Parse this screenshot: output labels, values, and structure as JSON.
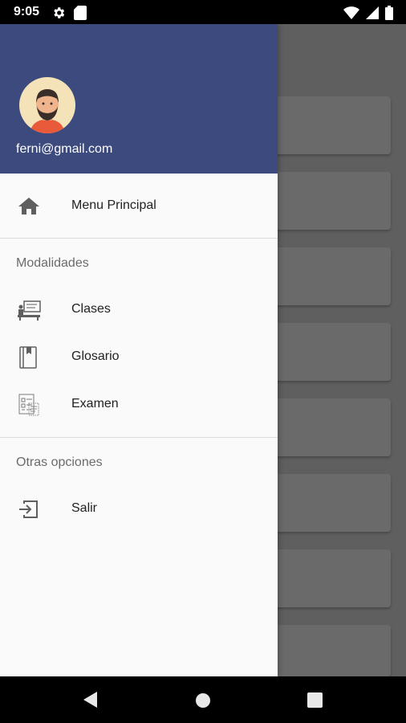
{
  "status_bar": {
    "time": "9:05",
    "left_icons": [
      "settings-icon",
      "sd-card-icon"
    ],
    "right_icons": [
      "wifi-icon",
      "signal-icon",
      "battery-icon"
    ]
  },
  "drawer": {
    "header": {
      "email": "ferni@gmail.com",
      "background_color": "#3c4a7d"
    },
    "primary_item": {
      "label": "Menu Principal",
      "icon": "home-icon"
    },
    "sections": [
      {
        "title": "Modalidades",
        "items": [
          {
            "label": "Clases",
            "icon": "classroom-icon"
          },
          {
            "label": "Glosario",
            "icon": "book-icon"
          },
          {
            "label": "Examen",
            "icon": "exam-icon"
          }
        ]
      },
      {
        "title": "Otras opciones",
        "items": [
          {
            "label": "Salir",
            "icon": "logout-icon"
          }
        ]
      }
    ]
  },
  "nav_bar": {
    "buttons": [
      "back-icon",
      "home-circle-icon",
      "recents-icon"
    ]
  }
}
